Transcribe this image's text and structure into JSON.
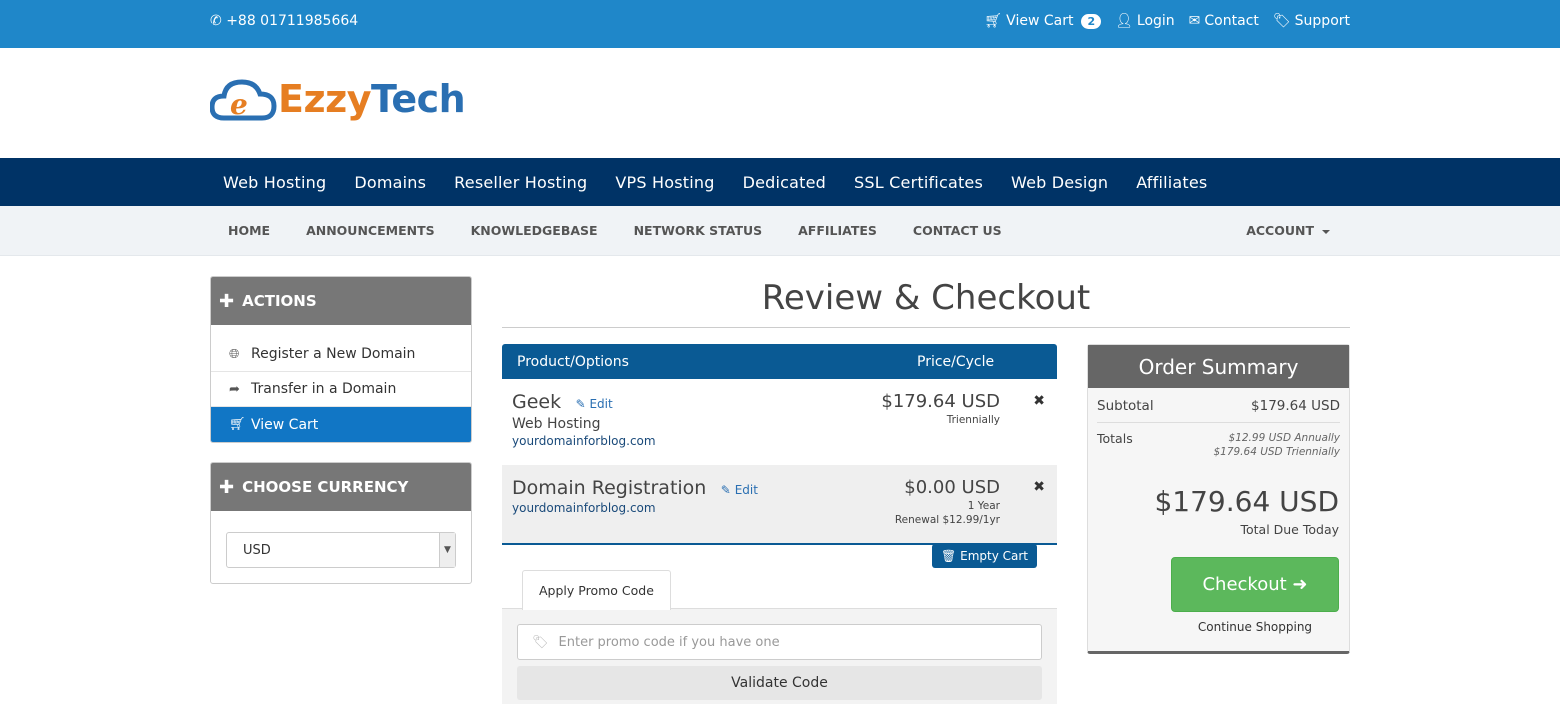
{
  "topbar": {
    "phone": "+88 01711985664",
    "view_cart": "View Cart",
    "cart_count": "2",
    "login": "Login",
    "contact": "Contact",
    "support": "Support"
  },
  "logo": {
    "part1": "Ezzy",
    "part2": "Tech",
    "letter": "e"
  },
  "main_nav": [
    "Web Hosting",
    "Domains",
    "Reseller Hosting",
    "VPS Hosting",
    "Dedicated",
    "SSL Certificates",
    "Web Design",
    "Affiliates"
  ],
  "sub_nav": [
    "HOME",
    "ANNOUNCEMENTS",
    "KNOWLEDGEBASE",
    "NETWORK STATUS",
    "AFFILIATES",
    "CONTACT US"
  ],
  "account": "ACCOUNT",
  "sidebar": {
    "actions_title": "ACTIONS",
    "actions": [
      {
        "label": "Register a New Domain"
      },
      {
        "label": "Transfer in a Domain"
      },
      {
        "label": "View Cart"
      }
    ],
    "currency_title": "CHOOSE CURRENCY",
    "currency_value": "USD"
  },
  "page_title": "Review & Checkout",
  "cart": {
    "col_product": "Product/Options",
    "col_price": "Price/Cycle",
    "items": [
      {
        "name": "Geek",
        "edit": "Edit",
        "sub": "Web Hosting",
        "domain": "yourdomainforblog.com",
        "price": "$179.64 USD",
        "cycle": "Triennially",
        "renewal": ""
      },
      {
        "name": "Domain Registration",
        "edit": "Edit",
        "sub": "",
        "domain": "yourdomainforblog.com",
        "price": "$0.00 USD",
        "cycle": "1 Year",
        "renewal": "Renewal $12.99/1yr"
      }
    ],
    "empty_cart": "Empty Cart"
  },
  "promo": {
    "tab": "Apply Promo Code",
    "placeholder": "Enter promo code if you have one",
    "validate": "Validate Code"
  },
  "summary": {
    "title": "Order Summary",
    "subtotal_label": "Subtotal",
    "subtotal_value": "$179.64 USD",
    "totals_label": "Totals",
    "totals_annual": "$12.99 USD Annually",
    "totals_triennial": "$179.64 USD Triennially",
    "total_due": "$179.64 USD",
    "total_due_label": "Total Due Today",
    "checkout": "Checkout",
    "continue": "Continue Shopping"
  },
  "colors": {
    "topbar": "#1f87c9",
    "mainnav": "#003366",
    "active": "#1176c5",
    "table_header": "#0a5a94",
    "checkout": "#5cb85c"
  }
}
